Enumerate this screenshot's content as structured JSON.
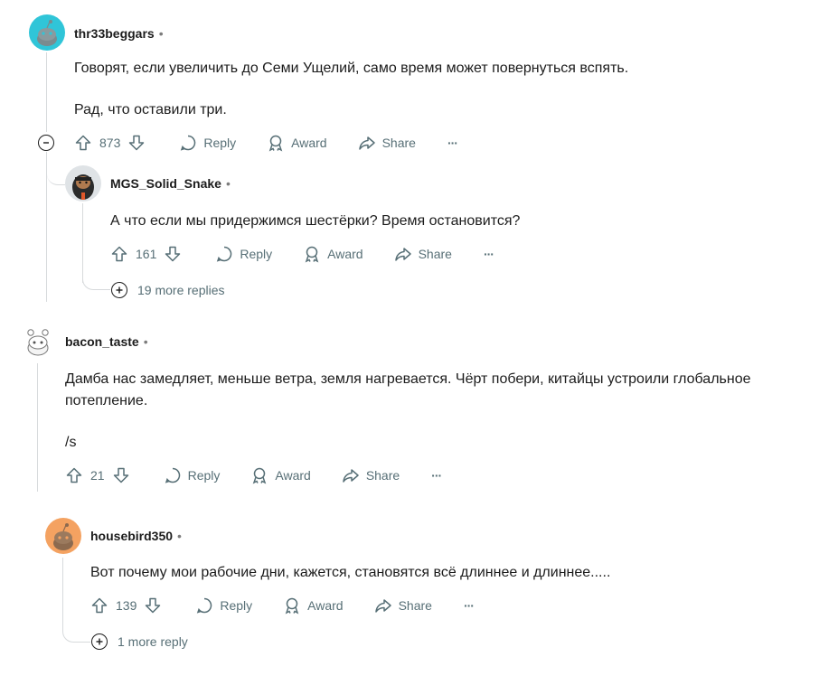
{
  "comments": [
    {
      "username": "thr33beggars",
      "dot": "•",
      "paragraphs": [
        "Говорят, если увеличить до Семи Ущелий, само время может повернуться вспять.",
        "Рад, что оставили три."
      ],
      "votes": "873",
      "reply_label": "Reply",
      "award_label": "Award",
      "share_label": "Share",
      "more_label": "···",
      "avatar_color": "#30c5d8"
    },
    {
      "username": "MGS_Solid_Snake",
      "dot": "•",
      "paragraphs": [
        "А что если мы придержимся шестёрки? Время остановится?"
      ],
      "votes": "161",
      "reply_label": "Reply",
      "award_label": "Award",
      "share_label": "Share",
      "more_label": "···",
      "more_replies": "19 more replies"
    },
    {
      "username": "bacon_taste",
      "dot": "•",
      "paragraphs": [
        "Дамба нас замедляет, меньше ветра, земля нагревается. Чёрт побери, китайцы устроили глобальное потепление.",
        "/s"
      ],
      "votes": "21",
      "reply_label": "Reply",
      "award_label": "Award",
      "share_label": "Share",
      "more_label": "···"
    },
    {
      "username": "housebird350",
      "dot": "•",
      "paragraphs": [
        "Вот почему мои рабочие дни, кажется, становятся всё длиннее и длиннее....."
      ],
      "votes": "139",
      "reply_label": "Reply",
      "award_label": "Award",
      "share_label": "Share",
      "more_label": "···",
      "more_replies": "1 more reply",
      "avatar_color": "#f4a261"
    }
  ],
  "colors": {
    "text": "#1c1c1c",
    "meta": "#576f76",
    "thread_line": "#d7dadc"
  }
}
